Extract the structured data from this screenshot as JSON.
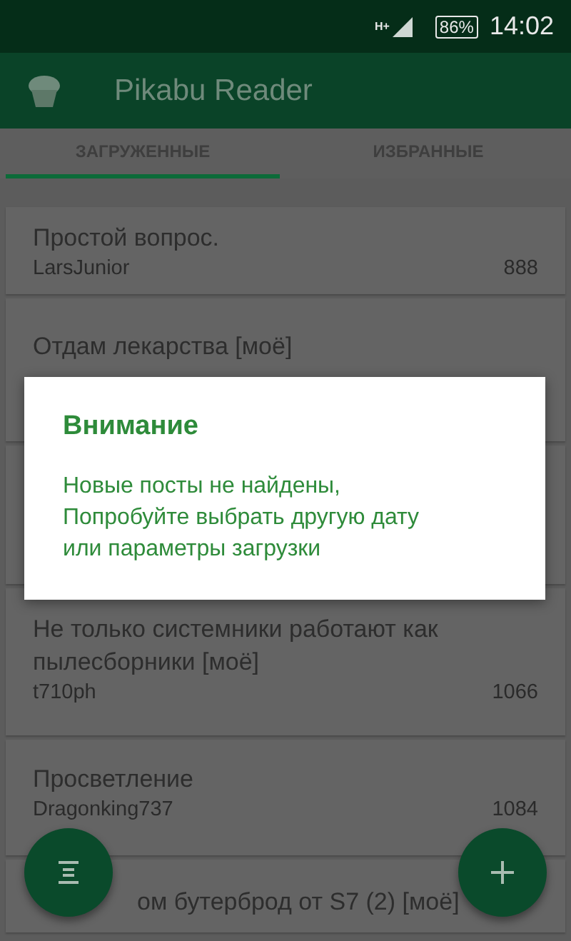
{
  "status_bar": {
    "network": "H+",
    "battery": "86%",
    "time": "14:02"
  },
  "app_bar": {
    "title": "Pikabu Reader"
  },
  "tabs": [
    {
      "label": "ЗАГРУЖЕННЫЕ",
      "selected": true
    },
    {
      "label": "ИЗБРАННЫЕ",
      "selected": false
    }
  ],
  "posts": [
    {
      "title": "Простой вопрос.",
      "author": "LarsJunior",
      "rating": "888"
    },
    {
      "title": "Отдам лекарства [моё]"
    },
    {
      "kind": "hidden"
    },
    {
      "title": "Не только системники работают как пылесборники [моё]",
      "author": "t710ph",
      "rating": "1066"
    },
    {
      "title": "Просветление",
      "author": "Dragonking737",
      "rating": "1084"
    },
    {
      "title": "ом бутерброд от S7 (2) [моё]",
      "kind": "cut"
    }
  ],
  "dialog": {
    "title": "Внимание",
    "message": "Новые посты не найдены,\nПопробуйте выбрать другую дату\nили параметры загрузки"
  }
}
